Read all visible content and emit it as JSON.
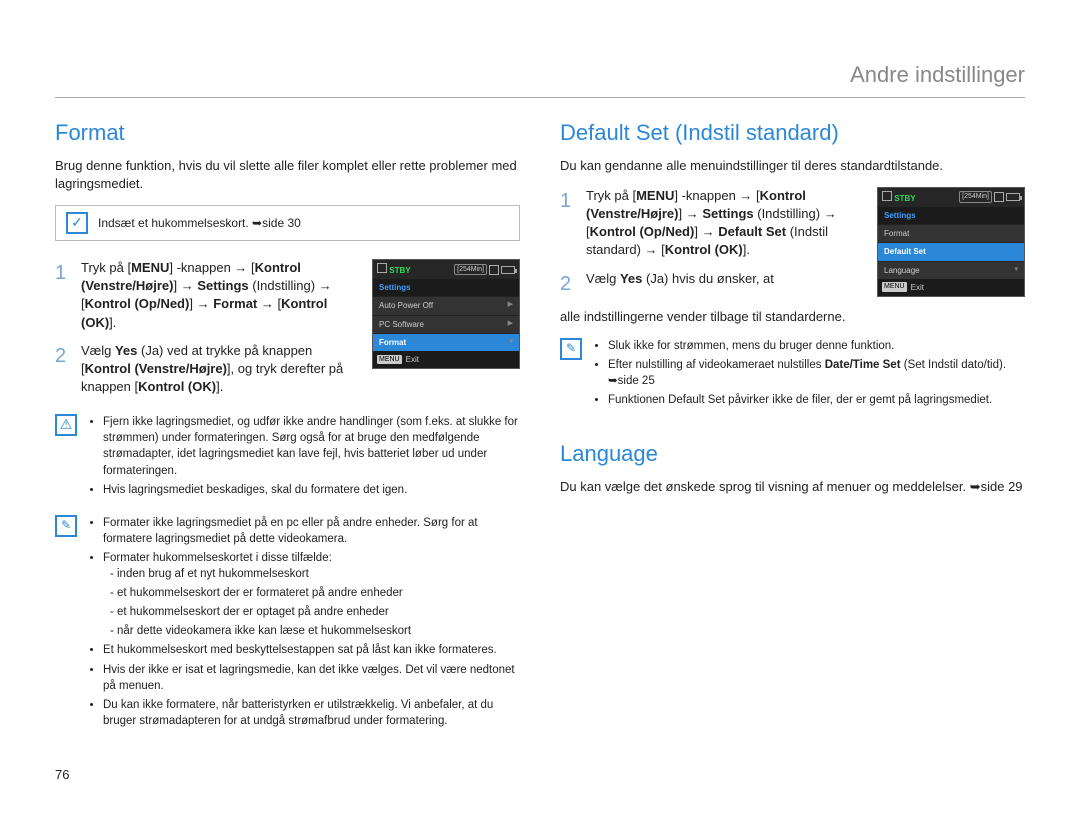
{
  "header": "Andre indstillinger",
  "pageNumber": "76",
  "left": {
    "title": "Format",
    "intro": "Brug denne funktion, hvis du vil slette alle filer komplet eller rette problemer med lagringsmediet.",
    "callout": "Indsæt et hukommelseskort. ➥side 30",
    "step1_num": "1",
    "step1": "Tryk på [MENU] -knappen → [Kontrol (Venstre/Højre)] → Settings (Indstilling) → [Kontrol (Op/Ned)] → Format → [Kontrol (OK)].",
    "step2_num": "2",
    "step2": "Vælg Yes (Ja) ved at trykke på knappen [Kontrol (Venstre/Højre)], og tryk derefter på knappen [Kontrol (OK)].",
    "warn": [
      "Fjern ikke lagringsmediet, og udfør ikke andre handlinger (som f.eks. at slukke for strømmen) under formateringen. Sørg også for at bruge den medfølgende strømadapter, idet lagringsmediet kan lave fejl, hvis batteriet løber ud under formateringen.",
      "Hvis lagringsmediet beskadiges, skal du formatere det igen."
    ],
    "notes": [
      "Formater ikke lagringsmediet på en pc eller på andre enheder. Sørg for at formatere lagringsmediet på dette videokamera.",
      "Formater hukommelseskortet i disse tilfælde:",
      "Et hukommelseskort med beskyttelsestappen sat på låst kan ikke formateres.",
      "Hvis der ikke er isat et lagringsmedie, kan det ikke vælges. Det vil være nedtonet på menuen.",
      "Du kan ikke formatere, når batteristyrken er utilstrækkelig. Vi anbefaler, at du bruger strømadapteren for at undgå strømafbrud under formatering."
    ],
    "subcases": [
      "inden brug af et nyt hukommelseskort",
      "et hukommelseskort der er formateret på andre enheder",
      "et hukommelseskort der er optaget på andre enheder",
      "når dette videokamera ikke kan læse et hukommelseskort"
    ],
    "lcd": {
      "stby": "STBY",
      "time": "[254Min]",
      "menuTitle": "Settings",
      "rows": [
        "Auto Power Off",
        "PC Software",
        "Format"
      ],
      "selectedRow": "Format",
      "exit": "Exit",
      "menuBtn": "MENU"
    }
  },
  "right": {
    "title1": "Default Set (Indstil standard)",
    "intro1": "Du kan gendanne alle menuindstillinger til deres standardtilstande.",
    "step1_num": "1",
    "step1": "Tryk på [MENU] -knappen → [Kontrol (Venstre/Højre)] → Settings (Indstilling) → [Kontrol (Op/Ned)] → Default Set (Indstil standard) → [Kontrol (OK)].",
    "step2_num": "2",
    "step2a": "Vælg Yes (Ja) hvis du ønsker, at",
    "step2b": "alle indstillingerne vender tilbage til standarderne.",
    "notes1": [
      "Sluk ikke for strømmen, mens du bruger denne funktion.",
      "Efter nulstilling af videokameraet nulstilles Date/Time Set (Set Indstil dato/tid). ➥side 25",
      "Funktionen Default Set påvirker ikke de filer, der er gemt på lagringsmediet."
    ],
    "lcd": {
      "stby": "STBY",
      "time": "[254Min]",
      "menuTitle": "Settings",
      "rows": [
        "Format",
        "Default Set",
        "Language"
      ],
      "selectedRow": "Default Set",
      "exit": "Exit",
      "menuBtn": "MENU"
    },
    "title2": "Language",
    "intro2": "Du kan vælge det ønskede sprog til visning af menuer og meddelelser. ➥side 29"
  }
}
